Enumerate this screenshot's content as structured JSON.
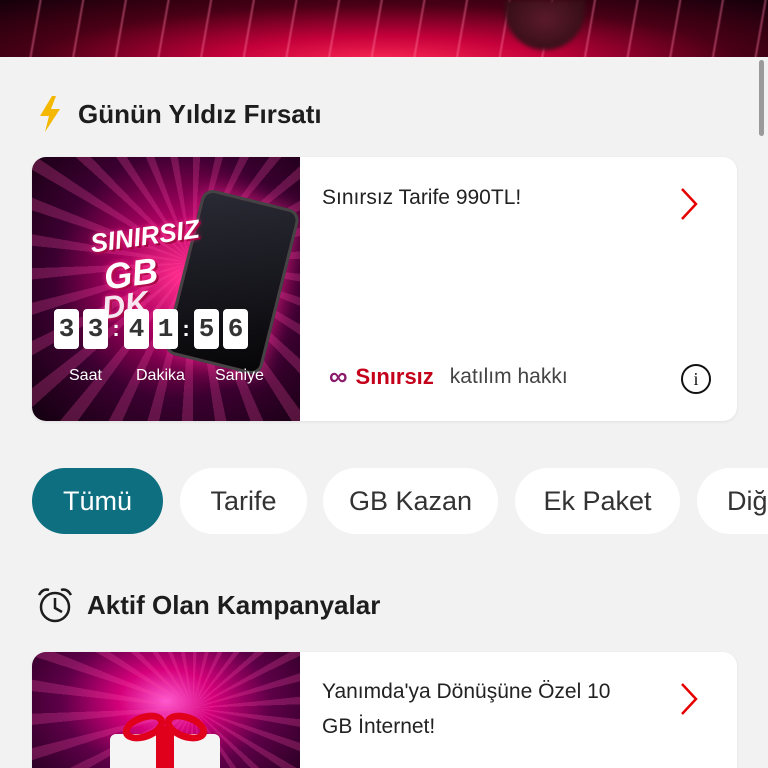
{
  "colors": {
    "accent_teal": "#0e6f80",
    "brand_red": "#e60000",
    "page_bg": "#f2f2f2",
    "lightning_yellow": "#f5b800"
  },
  "star_deal": {
    "section_title": "Günün Yıldız Fırsatı",
    "section_icon": "lightning-icon",
    "card": {
      "image_text_1": "SINIRSIZ",
      "image_text_2": "GB",
      "image_text_3": "DK",
      "countdown": {
        "hours": [
          "3",
          "3"
        ],
        "minutes": [
          "4",
          "1"
        ],
        "seconds": [
          "5",
          "6"
        ],
        "separator": ":",
        "labels": {
          "hours": "Saat",
          "minutes": "Dakika",
          "seconds": "Saniye"
        }
      },
      "title": "Sınırsız Tarife 990TL!",
      "badge_symbol": "∞",
      "badge_brand": "Sınırsız",
      "badge_text": "katılım hakkı",
      "info_icon": "info-icon",
      "info_symbol": "i"
    }
  },
  "filters": {
    "chips": [
      {
        "label": "Tümü",
        "active": true
      },
      {
        "label": "Tarife",
        "active": false
      },
      {
        "label": "GB Kazan",
        "active": false
      },
      {
        "label": "Ek Paket",
        "active": false
      },
      {
        "label": "Diğ",
        "active": false
      }
    ]
  },
  "active_campaigns": {
    "section_title": "Aktif Olan Kampanyalar",
    "section_icon": "alarm-clock-icon",
    "cards": [
      {
        "title_line_1": "Yanımda'ya Dönüşüne Özel 10",
        "title_line_2": "GB İnternet!"
      }
    ]
  }
}
